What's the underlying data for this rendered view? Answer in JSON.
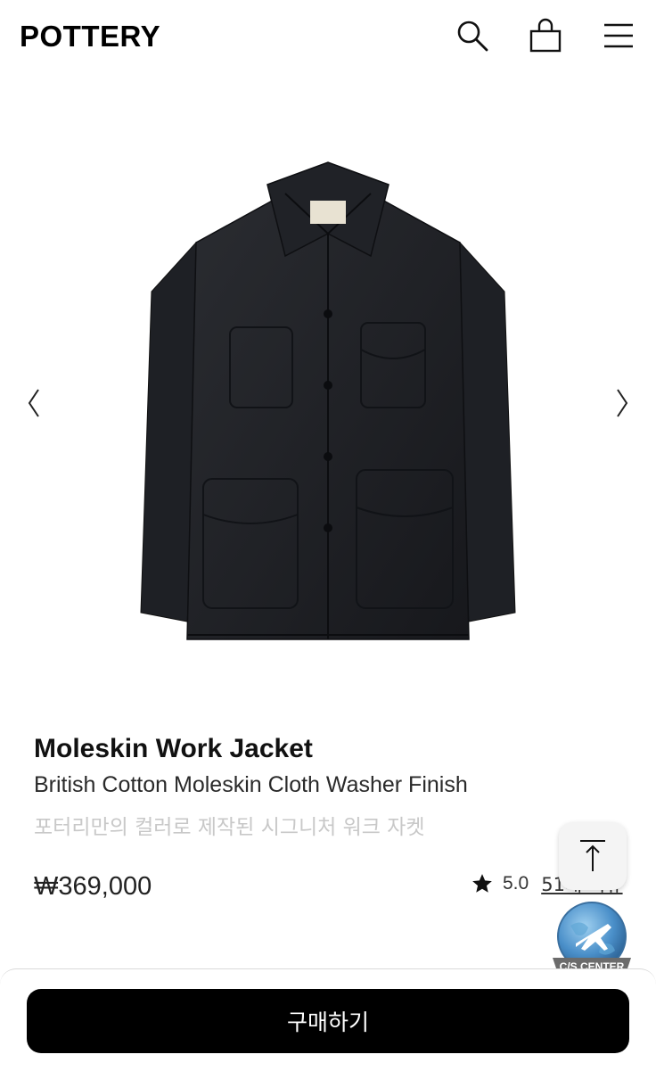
{
  "header": {
    "logo": "POTTERY",
    "icons": [
      "search-icon",
      "shopping-bag-icon",
      "hamburger-menu-icon"
    ]
  },
  "gallery": {
    "prev_glyph": "〈",
    "next_glyph": "〉",
    "image": "black moleskin work jacket with four patch pockets"
  },
  "product": {
    "title": "Moleskin Work Jacket",
    "subtitle": "British Cotton Moleskin Cloth Washer Finish",
    "description": "포터리만의 컬러로 제작된 시그니처 워크 자켓",
    "price": "₩369,000",
    "rating": {
      "score": "5.0",
      "reviews": "51개 리뷰"
    }
  },
  "floating": {
    "scroll_top_icon": "arrow-up-to-top-icon",
    "cs_label": "C/S CENTER"
  },
  "footer": {
    "buy_label": "구매하기"
  },
  "colors": {
    "accent": "#000000",
    "muted_text": "#c8c8c8",
    "badge_blue": "#4a8fc9"
  }
}
